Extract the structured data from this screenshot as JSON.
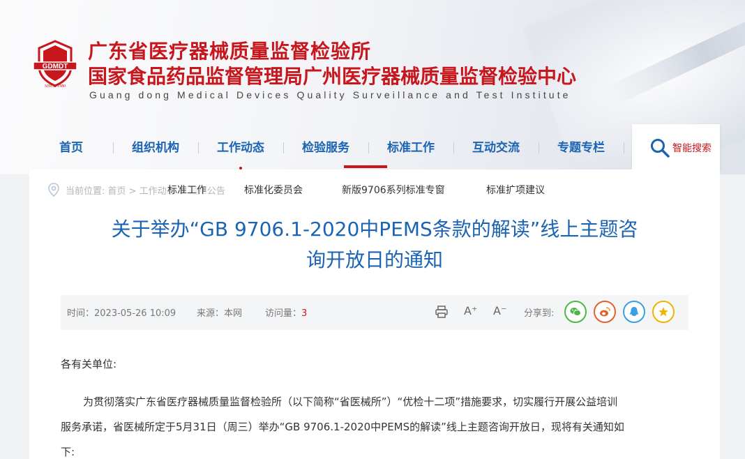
{
  "header": {
    "title_line1": "广东省医疗器械质量监督检验所",
    "title_line2": "国家食品药品监督管理局广州医疗器械质量监督检验中心",
    "title_en": "Guang dong Medical Devices Quality Surveillance and Test Institute",
    "logo_text": "GDMDT",
    "logo_since": "SINCE 1980"
  },
  "nav": {
    "items": [
      "首页",
      "组织机构",
      "工作动态",
      "检验服务",
      "标准工作",
      "互动交流",
      "专题专栏"
    ],
    "active": "标准工作",
    "search_label": "智能搜索"
  },
  "breadcrumb": {
    "text": "当前位置: 首页 > 工作动态 > 通知公告"
  },
  "subnav": {
    "items": [
      "标准工作",
      "标准化委员会",
      "新版9706系列标准专窗",
      "标准扩项建议"
    ]
  },
  "article": {
    "title_line1": "关于举办“GB 9706.1-2020中PEMS条款的解读”线上主题咨",
    "title_line2": "询开放日的通知",
    "meta": {
      "time_label": "时间：",
      "time_value": "2023-05-26 10:09",
      "source_label": "来源：",
      "source_value": "本网",
      "views_label": "访问量：",
      "views_value": "3",
      "font_up": "A⁺",
      "font_down": "A⁻",
      "share_label": "分享到:"
    },
    "greeting": "各有关单位:",
    "para1_line1": "为贯彻落实广东省医疗器械质量监督检验所（以下简称“省医械所”）“优检十二项”措施要求，切实履行开展公益培训",
    "para1_line2": "服务承诺，省医械所定于5月31日（周三）举办“GB 9706.1-2020中PEMS的解读”线上主题咨询开放日，现将有关通知如",
    "para1_line3": "下:"
  },
  "colors": {
    "brand_red": "#c8161d",
    "nav_blue": "#1b64b3",
    "wechat_green": "#4cb745",
    "weibo_orange": "#e6602c",
    "qq_blue": "#3aa0e0",
    "qzone_yellow": "#f0b400"
  }
}
